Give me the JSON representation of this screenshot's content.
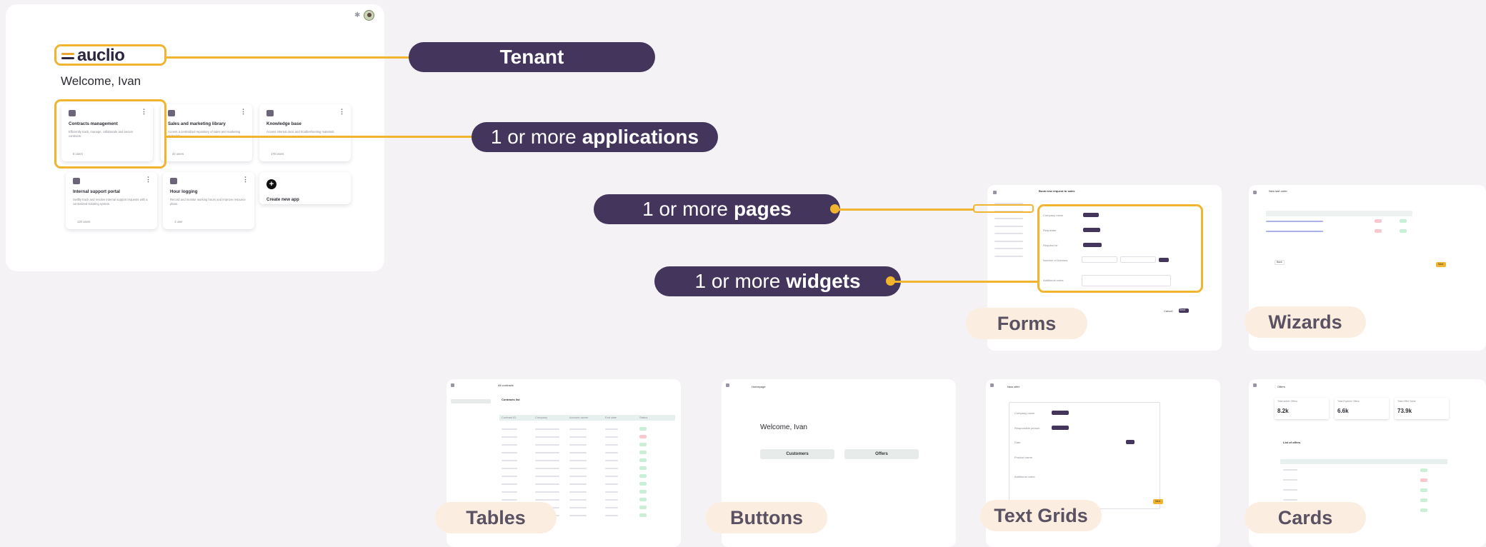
{
  "portal": {
    "logo_text": "auclio",
    "welcome": "Welcome, Ivan",
    "cards": [
      {
        "title": "Contracts management",
        "desc": "Efficiently track, manage, collaborate and secure contracts.",
        "users": "8 users"
      },
      {
        "title": "Sales and marketing library",
        "desc": "Access a centralized repository of sales and marketing materials.",
        "users": "42 users"
      },
      {
        "title": "Knowledge base",
        "desc": "Access internal docs and troubleshooting materials.",
        "users": "176 users"
      },
      {
        "title": "Internal support portal",
        "desc": "Swiftly track and resolve internal support requests with a centralized ticketing system.",
        "users": "120 users"
      },
      {
        "title": "Hour logging",
        "desc": "Record and monitor working hours and improve resource plans.",
        "users": "1 user"
      },
      {
        "title": "Create new app",
        "desc": "",
        "users": ""
      }
    ]
  },
  "callouts": {
    "tenant": "Tenant",
    "applications": {
      "prefix": "1 or more",
      "bold": "applications"
    },
    "pages": {
      "prefix": "1 or more",
      "bold": "pages"
    },
    "widgets": {
      "prefix": "1 or more",
      "bold": "widgets"
    }
  },
  "thumbnails": {
    "forms": {
      "label": "Forms",
      "title": "Book new request to sales",
      "fields": [
        "Company name",
        "Requester",
        "Request for",
        "Number of licenses",
        "Additional notes"
      ],
      "buttons": [
        "Cancel",
        "Send"
      ]
    },
    "wizards": {
      "label": "Wizards",
      "title": "New last order",
      "buttons": [
        "Back",
        "Next"
      ]
    },
    "tables": {
      "label": "Tables",
      "title": "All contracts",
      "subtitle": "Contracts list",
      "columns": [
        "Contract ID",
        "Company",
        "Account owner",
        "End date",
        "Status"
      ],
      "statuses": [
        "Active",
        "Expired",
        "Active",
        "Active",
        "Active",
        "Active",
        "Active",
        "Active",
        "Active",
        "Active",
        "Active",
        "Active"
      ]
    },
    "buttons": {
      "label": "Buttons",
      "title": "Homepage",
      "welcome": "Welcome, Ivan",
      "actions": [
        "Customers",
        "Offers"
      ]
    },
    "text_grids": {
      "label": "Text Grids",
      "title": "New offer",
      "fields": [
        "Company name",
        "Responsible person",
        "Date",
        "Product name",
        "Additional notes"
      ],
      "button": "Next"
    },
    "cards": {
      "label": "Cards",
      "title": "Offers",
      "stats": [
        {
          "label": "Total active Offers",
          "value": "8.2k"
        },
        {
          "label": "Total Expired Offers",
          "value": "6.6k"
        },
        {
          "label": "Total Offer Value",
          "value": "73.9k"
        }
      ],
      "list_title": "List of offers"
    }
  },
  "colors": {
    "accent": "#f0b42e",
    "pill": "#44355c",
    "tag": "#fbeee1",
    "background": "#f4f2f5"
  }
}
